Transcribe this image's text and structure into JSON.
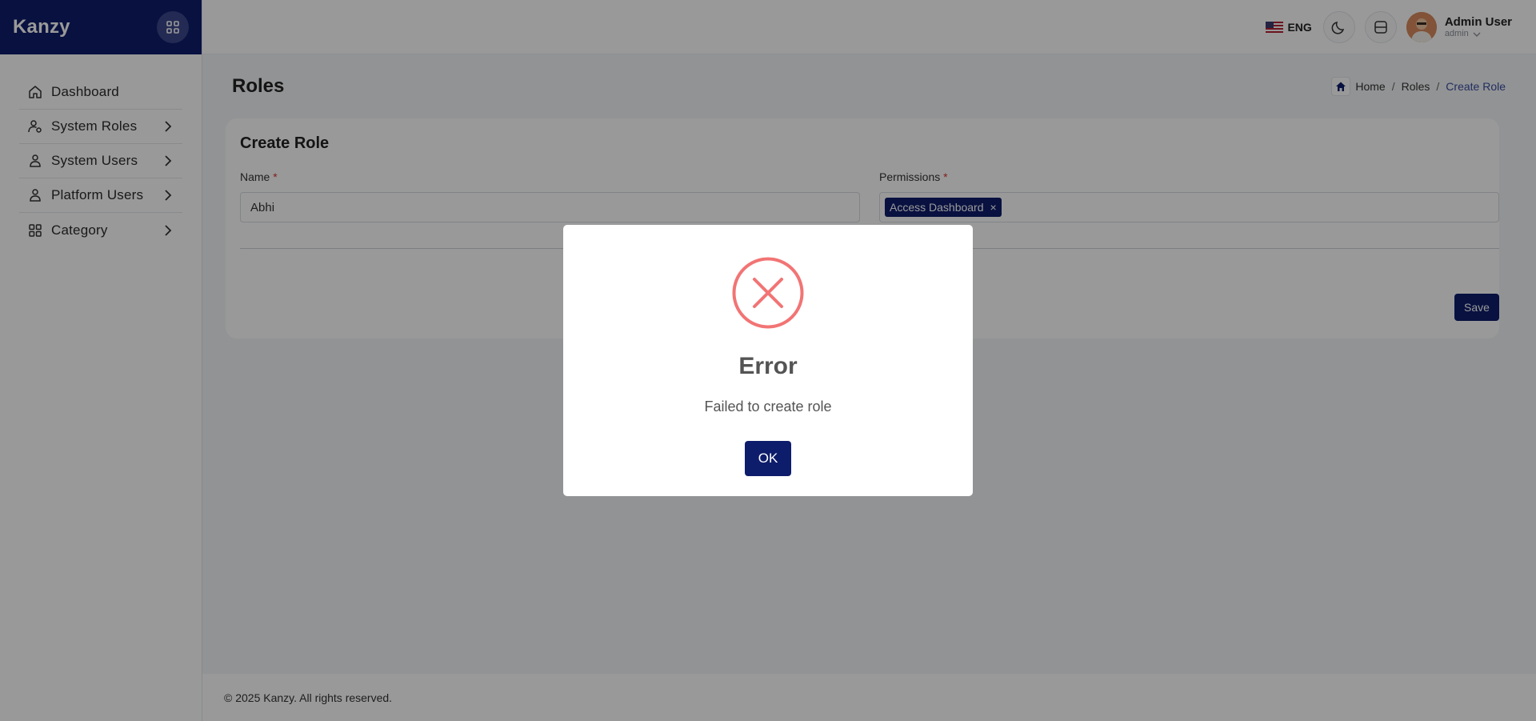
{
  "brand": {
    "name": "Kanzy",
    "color": "#0e1d6b"
  },
  "sidebar": {
    "items": [
      {
        "label": "Dashboard",
        "icon": "home-icon",
        "has_children": false
      },
      {
        "label": "System Roles",
        "icon": "user-gear-icon",
        "has_children": true
      },
      {
        "label": "System Users",
        "icon": "user-icon",
        "has_children": true
      },
      {
        "label": "Platform Users",
        "icon": "user-icon",
        "has_children": true
      },
      {
        "label": "Category",
        "icon": "grid-icon",
        "has_children": true
      }
    ]
  },
  "header": {
    "language": "ENG",
    "user": {
      "name": "Admin User",
      "role": "admin"
    }
  },
  "page": {
    "title": "Roles",
    "breadcrumb": [
      "Home",
      "Roles",
      "Create Role"
    ]
  },
  "form": {
    "title": "Create Role",
    "name_label": "Name",
    "name_value": "Abhi",
    "permissions_label": "Permissions",
    "required_mark": "*",
    "permissions": [
      "Access Dashboard"
    ],
    "tag_remove": "×",
    "save_label": "Save"
  },
  "footer": {
    "text": "© 2025 Kanzy. All rights reserved."
  },
  "dialog": {
    "title": "Error",
    "message": "Failed to create role",
    "ok_label": "OK",
    "icon": "error-x-icon",
    "icon_color": "#f27474"
  }
}
